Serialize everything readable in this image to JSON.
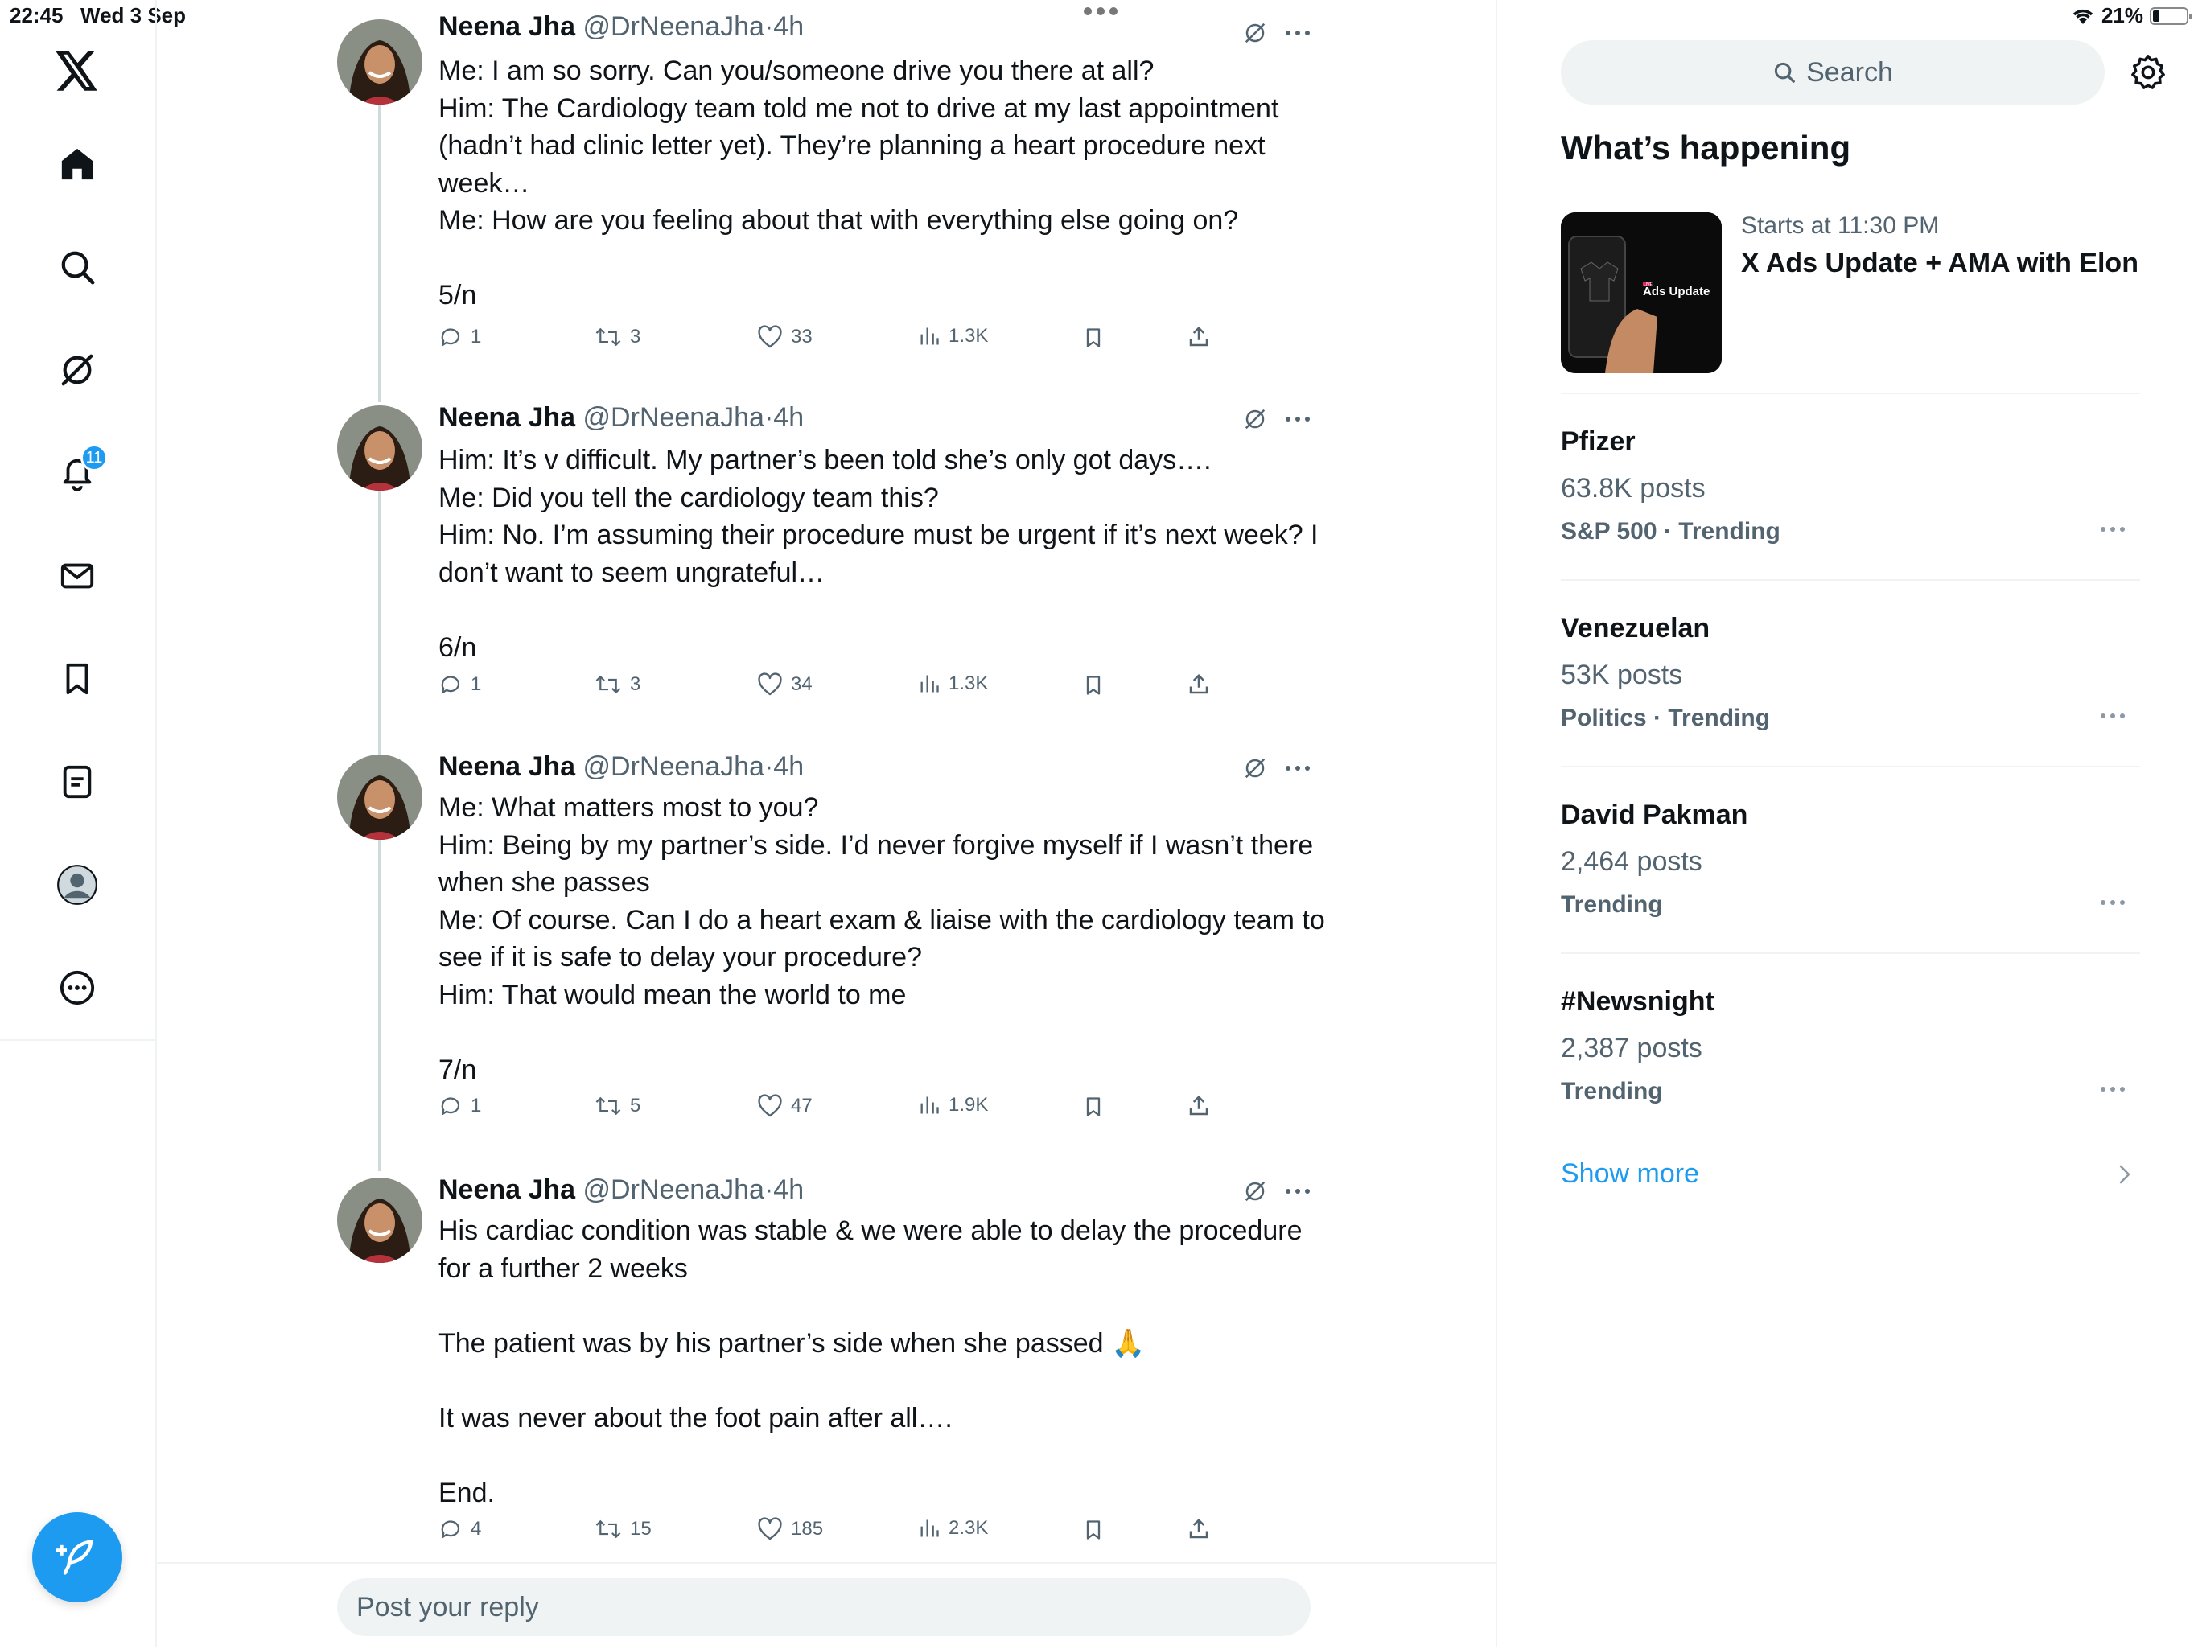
{
  "status_bar": {
    "time": "22:45",
    "date": "Wed 3 Sep",
    "battery": "21%"
  },
  "nav": {
    "notifications_badge": "11"
  },
  "tweets": [
    {
      "name": "Neena Jha",
      "handle": "@DrNeenaJha",
      "time": "4h",
      "text": "Me: I am so sorry. Can you/someone drive you there at all?\nHim: The Cardiology team told me not to drive at my last appointment (hadn’t had clinic letter yet). They’re planning a heart procedure next week…\nMe: How are you feeling about that with everything else going on?\n\n5/n",
      "replies": "1",
      "reposts": "3",
      "likes": "33",
      "views": "1.3K"
    },
    {
      "name": "Neena Jha",
      "handle": "@DrNeenaJha",
      "time": "4h",
      "text": "Him: It’s v difficult. My partner’s been told she’s only got days….\nMe: Did you tell the cardiology team this?\nHim: No. I’m assuming their procedure must be urgent if it’s next week? I don’t want to seem ungrateful…\n\n6/n",
      "replies": "1",
      "reposts": "3",
      "likes": "34",
      "views": "1.3K"
    },
    {
      "name": "Neena Jha",
      "handle": "@DrNeenaJha",
      "time": "4h",
      "text": "Me: What matters most to you?\nHim: Being by my partner’s side. I’d never forgive myself if I wasn’t there when she passes\nMe: Of course. Can I do a heart exam & liaise with the cardiology team to see if it is safe to delay your procedure?\nHim: That would mean the world to me\n\n7/n",
      "replies": "1",
      "reposts": "5",
      "likes": "47",
      "views": "1.9K"
    },
    {
      "name": "Neena Jha",
      "handle": "@DrNeenaJha",
      "time": "4h",
      "text": "His cardiac condition was stable & we were able to delay the procedure for a further 2 weeks\n\nThe patient was by his partner’s side when she passed 🙏\n\nIt was never about the foot pain after all….\n\nEnd.",
      "replies": "4",
      "reposts": "15",
      "likes": "185",
      "views": "2.3K"
    }
  ],
  "reply": {
    "placeholder": "Post your reply"
  },
  "sidebar": {
    "search_placeholder": "Search",
    "section_title": "What’s happening",
    "event": {
      "time": "Starts at 11:30 PM",
      "title": "X Ads Update + AMA with Elon",
      "thumb_text": "Ads Update",
      "thumb_live": "LIVE"
    },
    "trends": [
      {
        "name": "Pfizer",
        "posts": "63.8K posts",
        "context": "S&P 500 · Trending"
      },
      {
        "name": "Venezuelan",
        "posts": "53K posts",
        "context": "Politics · Trending"
      },
      {
        "name": "David Pakman",
        "posts": "2,464 posts",
        "context": "Trending"
      },
      {
        "name": "#Newsnight",
        "posts": "2,387 posts",
        "context": "Trending"
      }
    ],
    "show_more": "Show more"
  },
  "colors": {
    "accent": "#1d9bf0",
    "text_primary": "#0f1419",
    "text_secondary": "#536471",
    "border": "#eff3f4"
  },
  "icons": {
    "nav": [
      "x-logo-icon",
      "home-icon",
      "search-icon",
      "grok-icon",
      "bell-icon",
      "mail-icon",
      "bookmark-icon",
      "lists-icon",
      "profile-icon",
      "more-circle-icon"
    ],
    "tweet_actions": [
      "reply-icon",
      "repost-icon",
      "like-icon",
      "views-icon",
      "bookmark-icon",
      "share-icon"
    ]
  }
}
